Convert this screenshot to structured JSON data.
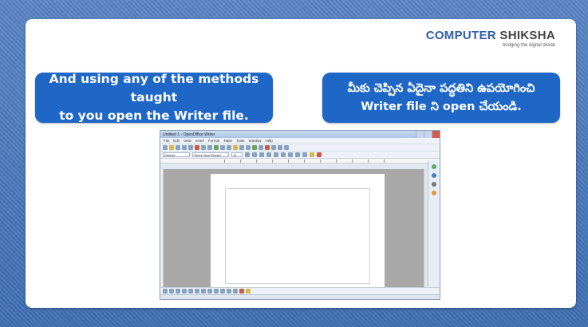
{
  "logo": {
    "part1": "COMPUTER",
    "part2": "SHIKSHA",
    "tagline": "bridging the digital divide"
  },
  "bubbles": {
    "english": "And using any of the methods taught\nto you open the Writer file.",
    "telugu": "మీకు చెప్పిన ఏదైనా పద్ధతిని ఉపయోగించి\nWriter file ని open చేయండి."
  },
  "writer": {
    "title": "Untitled 1 - OpenOffice Writer",
    "menu": [
      "File",
      "Edit",
      "View",
      "Insert",
      "Format",
      "Table",
      "Tools",
      "Window",
      "Help"
    ],
    "style_value": "Default",
    "font_value": "Times New Roman",
    "size_value": "12"
  },
  "colors": {
    "background": "#4a78b8",
    "bubble": "#1f67c6",
    "logo_blue": "#2f5da8"
  }
}
